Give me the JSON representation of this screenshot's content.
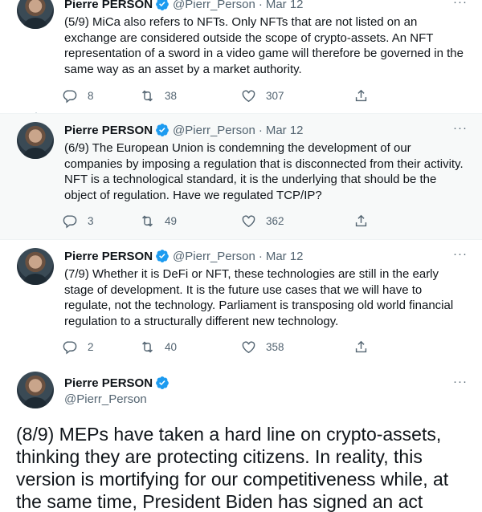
{
  "tweets": [
    {
      "name": "Pierre PERSON",
      "handle": "@Pierr_Person",
      "dot": "·",
      "date": "Mar 12",
      "more": "···",
      "text": "(5/9) MiCa also refers to NFTs. Only NFTs that are not listed on an exchange are considered outside the scope of crypto-assets. An NFT representation of a sword in a video game will therefore be governed in the same way as an asset by a market authority.",
      "replies": "8",
      "retweets": "38",
      "likes": "307"
    },
    {
      "name": "Pierre PERSON",
      "handle": "@Pierr_Person",
      "dot": "·",
      "date": "Mar 12",
      "more": "···",
      "text": "(6/9) The European Union is condemning the development of our companies by imposing a regulation that is disconnected from their activity. NFT is a technological standard, it is the underlying that should be the object of regulation. Have we regulated TCP/IP?",
      "replies": "3",
      "retweets": "49",
      "likes": "362"
    },
    {
      "name": "Pierre PERSON",
      "handle": "@Pierr_Person",
      "dot": "·",
      "date": "Mar 12",
      "more": "···",
      "text": "(7/9) Whether it is DeFi or NFT, these technologies are still in the early stage of development. It is the future use cases that we will have to regulate, not the technology.  Parliament is transposing old world financial regulation to a structurally different new technology.",
      "replies": "2",
      "retweets": "40",
      "likes": "358"
    }
  ],
  "main_tweet": {
    "name": "Pierre PERSON",
    "handle": "@Pierr_Person",
    "more": "···",
    "text": "(8/9) MEPs have taken a hard line on crypto-assets, thinking they are protecting citizens. In reality, this version is mortifying for our competitiveness while, at the same time, President Biden has signed an act"
  },
  "colors": {
    "accent": "#1d9bf0",
    "secondary_text": "#536471",
    "highlight_bg": "#f7f9f9"
  }
}
